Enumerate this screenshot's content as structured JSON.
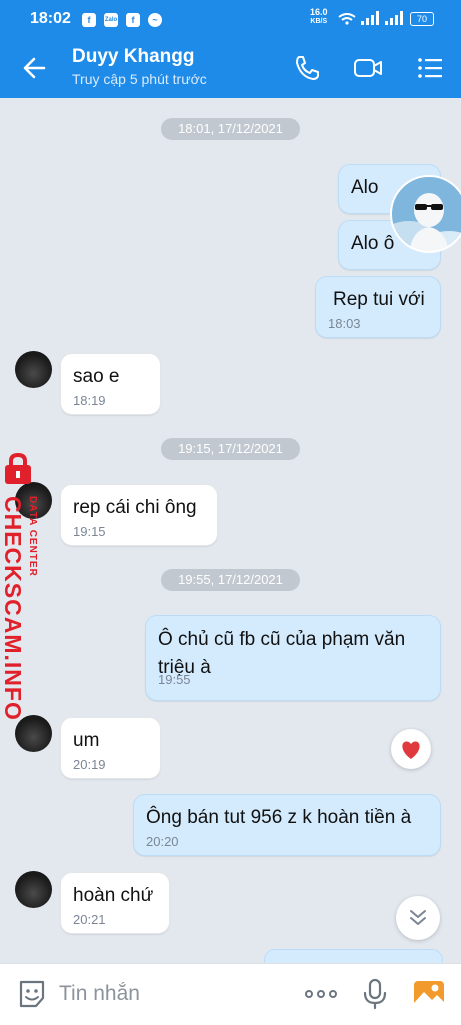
{
  "status_bar": {
    "time": "18:02",
    "net_speed": "16.0",
    "net_unit": "KB/S",
    "battery": "70"
  },
  "header": {
    "name": "Duyy Khangg",
    "status": "Truy cập 5 phút trước"
  },
  "timestamps": [
    "18:01, 17/12/2021",
    "19:15, 17/12/2021",
    "19:55, 17/12/2021"
  ],
  "messages": [
    {
      "dir": "sent",
      "text": "Alo",
      "time": ""
    },
    {
      "dir": "sent",
      "text": "Alo ô",
      "time": ""
    },
    {
      "dir": "sent",
      "text": "Rep tui với",
      "time": "18:03"
    },
    {
      "dir": "recv",
      "text": "sao e",
      "time": "18:19"
    },
    {
      "dir": "recv",
      "text": "rep cái chi ông",
      "time": "19:15"
    },
    {
      "dir": "sent",
      "text": "Ô chủ cũ fb cũ của phạm văn triệu à",
      "time": "19:55"
    },
    {
      "dir": "recv",
      "text": "um",
      "time": "20:19"
    },
    {
      "dir": "sent",
      "text": "Ông bán tut 956 z k hoàn tiền à",
      "time": "20:20"
    },
    {
      "dir": "recv",
      "text": "hoàn chứ",
      "time": "20:21"
    }
  ],
  "composer": {
    "placeholder": "Tin nhắn"
  },
  "watermark": {
    "text": "CHECKSCAM.INFO",
    "sub": "DATA CENTER"
  },
  "colors": {
    "accent": "#1f8be8",
    "sent_bubble": "#d4ebfd",
    "recv_bubble": "#ffffff",
    "watermark": "#e0202a"
  }
}
